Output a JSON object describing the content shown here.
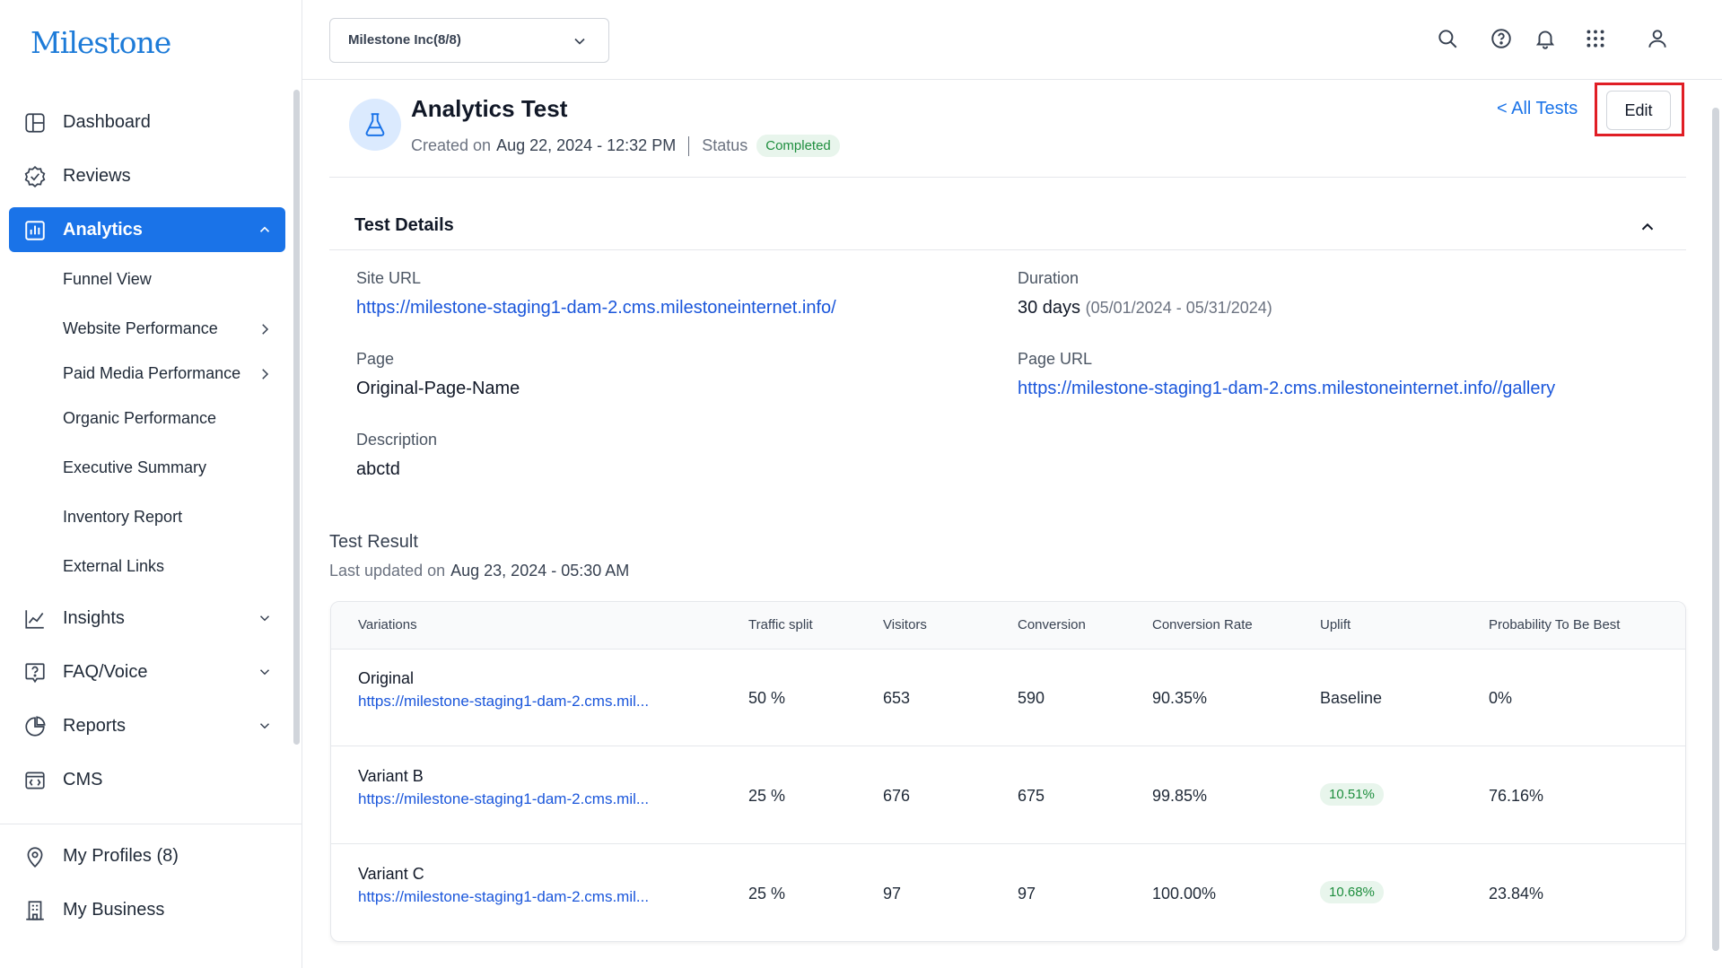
{
  "brand": {
    "logo_text": "Milestone",
    "accent": "#1a73e8"
  },
  "sidebar": {
    "items": [
      {
        "label": "Dashboard",
        "icon": "dashboard-icon"
      },
      {
        "label": "Reviews",
        "icon": "reviews-icon"
      },
      {
        "label": "Analytics",
        "icon": "analytics-icon",
        "active": true,
        "expanded": true
      },
      {
        "label": "Insights",
        "icon": "insights-icon"
      },
      {
        "label": "FAQ/Voice",
        "icon": "faq-icon"
      },
      {
        "label": "Reports",
        "icon": "reports-icon"
      },
      {
        "label": "CMS",
        "icon": "cms-icon"
      }
    ],
    "analytics_sub": [
      "Funnel View",
      "Website Performance",
      "Paid Media Performance",
      "Organic Performance",
      "Executive Summary",
      "Inventory Report",
      "External Links"
    ],
    "bottom": [
      {
        "label": "My Profiles (8)",
        "icon": "location-pin-icon"
      },
      {
        "label": "My Business",
        "icon": "building-icon"
      }
    ]
  },
  "header": {
    "org_select": "Milestone Inc(8/8)",
    "icons": [
      "search-icon",
      "help-icon",
      "bell-icon",
      "apps-grid-icon",
      "user-icon"
    ]
  },
  "test": {
    "title": "Analytics Test",
    "created_label": "Created on",
    "created_date": "Aug 22, 2024 - 12:32 PM",
    "status_label": "Status",
    "status": "Completed",
    "all_tests_link": "< All Tests",
    "edit_label": "Edit"
  },
  "details": {
    "heading": "Test Details",
    "site_url_label": "Site URL",
    "site_url": "https://milestone-staging1-dam-2.cms.milestoneinternet.info/",
    "duration_label": "Duration",
    "duration": "30 days",
    "duration_range": "(05/01/2024 - 05/31/2024)",
    "page_label": "Page",
    "page": "Original-Page-Name",
    "page_url_label": "Page URL",
    "page_url": "https://milestone-staging1-dam-2.cms.milestoneinternet.info//gallery",
    "description_label": "Description",
    "description": "abctd"
  },
  "result": {
    "title": "Test Result",
    "updated_label": "Last updated on",
    "updated_date": "Aug 23, 2024 - 05:30 AM",
    "columns": [
      "Variations",
      "Traffic split",
      "Visitors",
      "Conversion",
      "Conversion Rate",
      "Uplift",
      "Probability To Be Best"
    ],
    "rows": [
      {
        "name": "Original",
        "url": "https://milestone-staging1-dam-2.cms.mil...",
        "traffic": "50 %",
        "visitors": "653",
        "conversion": "590",
        "rate": "90.35%",
        "uplift": "Baseline",
        "prob": "0%"
      },
      {
        "name": "Variant B",
        "url": "https://milestone-staging1-dam-2.cms.mil...",
        "traffic": "25 %",
        "visitors": "676",
        "conversion": "675",
        "rate": "99.85%",
        "uplift": "10.51%",
        "prob": "76.16%"
      },
      {
        "name": "Variant C",
        "url": "https://milestone-staging1-dam-2.cms.mil...",
        "traffic": "25 %",
        "visitors": "97",
        "conversion": "97",
        "rate": "100.00%",
        "uplift": "10.68%",
        "prob": "23.84%"
      }
    ]
  },
  "colors": {
    "link": "#1a56db",
    "success_bg": "#e8f5ec",
    "success_text": "#1e8e3e",
    "highlight_border": "#e01e25"
  }
}
